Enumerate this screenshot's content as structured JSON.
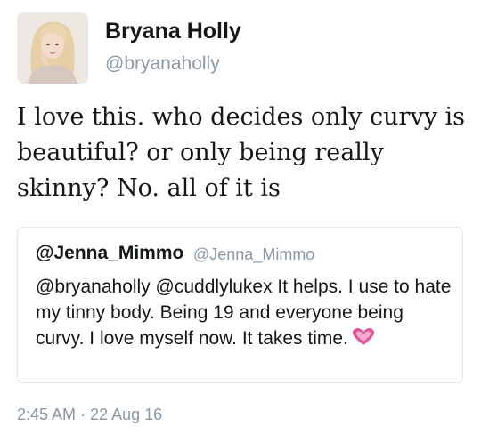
{
  "author": {
    "display_name": "Bryana Holly",
    "handle": "@bryanaholly",
    "avatar_icon": "profile-photo"
  },
  "tweet": {
    "text": "I love this. who decides only curvy is beautiful? or only being really skinny? No. all of it is",
    "timestamp": "2:45 AM · 22 Aug 16"
  },
  "quoted_tweet": {
    "display_name": "@Jenna_Mimmo",
    "handle": "@Jenna_Mimmo",
    "text": "@bryanaholly @cuddlylukex It helps. I use to hate my tinny body. Being 19 and everyone being curvy. I love  myself now. It takes time.",
    "emoji_icon": "pink-heart-icon"
  },
  "colors": {
    "text": "#14171a",
    "muted": "#8899a6",
    "border": "#e1e8ed",
    "heart": "#e0569b"
  }
}
